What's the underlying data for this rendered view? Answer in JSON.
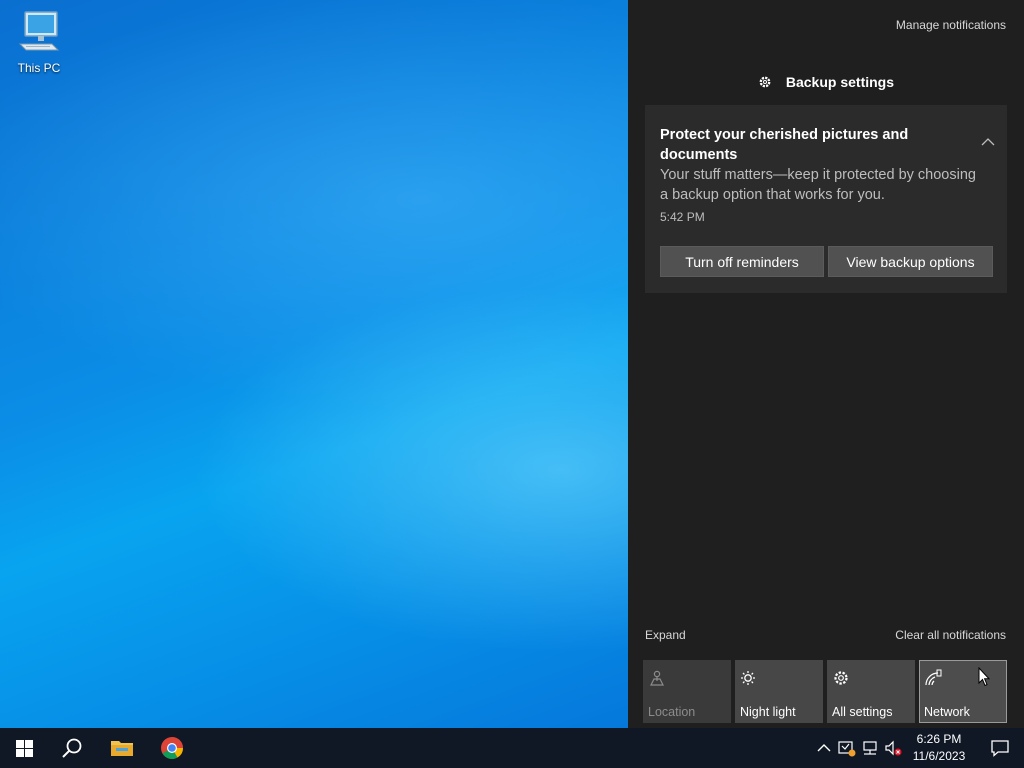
{
  "desktop": {
    "icons": [
      {
        "label": "This PC",
        "icon": "this-pc-icon"
      }
    ]
  },
  "action_center": {
    "manage_notifications": "Manage notifications",
    "group_title": "Backup settings",
    "toast": {
      "title": "Protect your cherished pictures and documents",
      "body": "Your stuff matters—keep it protected by choosing a backup option that works for you.",
      "time": "5:42 PM",
      "buttons": {
        "turn_off": "Turn off reminders",
        "view": "View backup options"
      }
    },
    "expand": "Expand",
    "clear_all": "Clear all notifications",
    "quick_actions": [
      {
        "label": "Location",
        "icon": "location-icon",
        "state": "disabled"
      },
      {
        "label": "Night light",
        "icon": "night-light-icon",
        "state": "off"
      },
      {
        "label": "All settings",
        "icon": "gear-icon",
        "state": "off"
      },
      {
        "label": "Network",
        "icon": "network-icon",
        "state": "hover"
      }
    ]
  },
  "taskbar": {
    "apps": [
      "start-icon",
      "search-icon",
      "file-explorer-icon",
      "chrome-icon"
    ],
    "tray": [
      "chevron-up-icon",
      "windows-security-icon",
      "network-icon",
      "volume-muted-icon"
    ],
    "clock": {
      "time": "6:26 PM",
      "date": "11/6/2023"
    }
  },
  "colors": {
    "panel_bg": "#1f1f1f",
    "toast_bg": "#2b2b2b",
    "button_bg": "#515151",
    "tile_bg": "#474747",
    "taskbar_bg": "#101825"
  }
}
